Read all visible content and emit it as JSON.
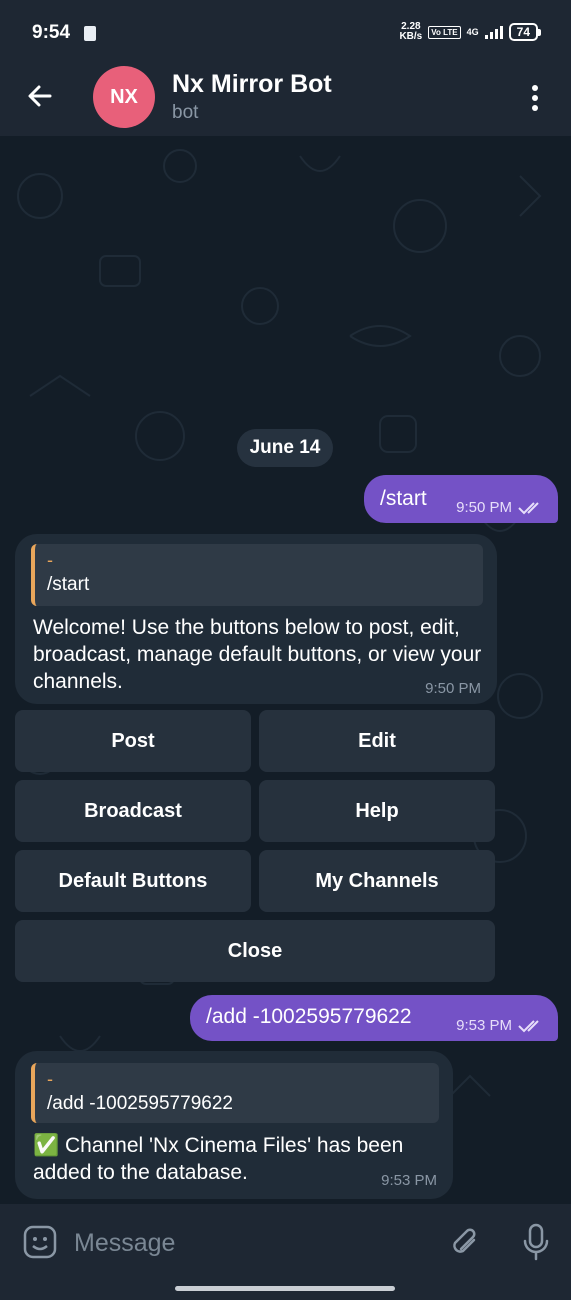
{
  "status_bar": {
    "time": "9:54",
    "speed_value": "2.28",
    "speed_unit": "KB/s",
    "volte": "Vo LTE",
    "network": "4G",
    "battery": "74"
  },
  "header": {
    "avatar_initials": "NX",
    "avatar_color": "#e8607a",
    "title": "Nx Mirror Bot",
    "subtitle": "bot"
  },
  "chat": {
    "date": "June 14",
    "messages": [
      {
        "text": "/start",
        "time": "9:50 PM"
      },
      {
        "reply_dash": "-",
        "reply_text": "/start",
        "body": "Welcome! Use the buttons below to post, edit, broadcast, manage default buttons, or view your channels.",
        "time": "9:50 PM"
      },
      {
        "text": "/add -1002595779622",
        "time": "9:53 PM"
      },
      {
        "reply_dash": "-",
        "reply_text": "/add -1002595779622",
        "body": "✅ Channel 'Nx Cinema Files' has been added to the database.",
        "time": "9:53 PM"
      }
    ],
    "keyboard": {
      "post": "Post",
      "edit": "Edit",
      "broadcast": "Broadcast",
      "help": "Help",
      "default_buttons": "Default Buttons",
      "my_channels": "My Channels",
      "close": "Close"
    }
  },
  "input": {
    "placeholder": "Message"
  },
  "colors": {
    "outgoing_bubble": "#7452c6",
    "incoming_bubble": "#202c38",
    "reply_accent": "#e9a65b",
    "header_bg": "#1e2733"
  }
}
